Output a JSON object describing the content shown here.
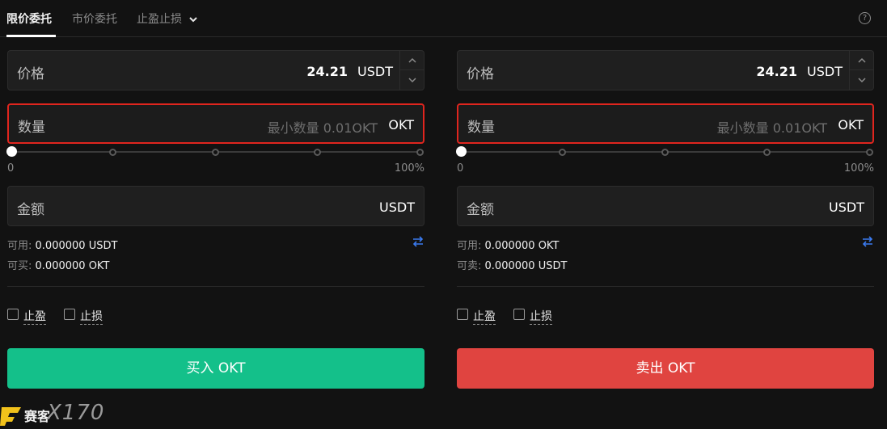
{
  "tabs": [
    {
      "label": "限价委托",
      "active": true
    },
    {
      "label": "市价委托",
      "active": false
    },
    {
      "label": "止盈止损",
      "active": false
    }
  ],
  "help_icon": "question-circle-icon",
  "buy": {
    "price_label": "价格",
    "price_value": "24.21",
    "price_unit": "USDT",
    "qty_label": "数量",
    "qty_placeholder": "最小数量 0.01OKT",
    "qty_unit": "OKT",
    "slider_min": "0",
    "slider_max": "100%",
    "slider_value": 0,
    "amount_label": "金额",
    "amount_unit": "USDT",
    "available_label": "可用:",
    "available_value": "0.000000 USDT",
    "can_label": "可买:",
    "can_value": "0.000000 OKT",
    "take_profit": "止盈",
    "stop_loss": "止损",
    "action": "买入 OKT",
    "color": "#14c08a"
  },
  "sell": {
    "price_label": "价格",
    "price_value": "24.21",
    "price_unit": "USDT",
    "qty_label": "数量",
    "qty_placeholder": "最小数量 0.01OKT",
    "qty_unit": "OKT",
    "slider_min": "0",
    "slider_max": "100%",
    "slider_value": 0,
    "amount_label": "金额",
    "amount_unit": "USDT",
    "available_label": "可用:",
    "available_value": "0.000000 OKT",
    "can_label": "可卖:",
    "can_value": "0.000000 USDT",
    "take_profit": "止盈",
    "stop_loss": "止损",
    "action": "卖出 OKT",
    "color": "#e04440"
  },
  "highlight_color": "#e0251e",
  "watermark": {
    "text": "赛客",
    "num": "X170"
  }
}
